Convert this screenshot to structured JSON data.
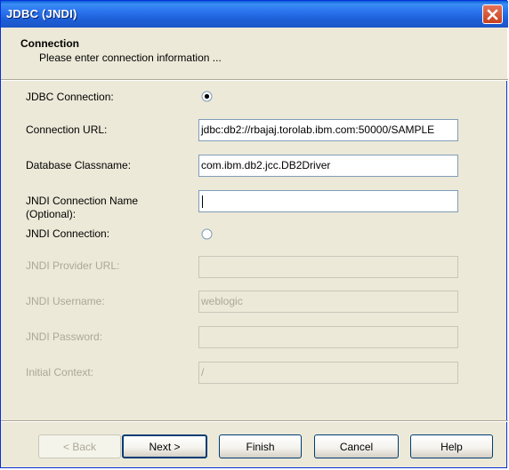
{
  "window": {
    "title": "JDBC (JNDI)"
  },
  "header": {
    "title": "Connection",
    "subtitle": "Please enter connection information ..."
  },
  "form": {
    "jdbc_connection_label": "JDBC Connection:",
    "connection_url_label": "Connection URL:",
    "connection_url_value": "jdbc:db2://rbajaj.torolab.ibm.com:50000/SAMPLE",
    "db_classname_label": "Database Classname:",
    "db_classname_value": "com.ibm.db2.jcc.DB2Driver",
    "jndi_conn_name_label": "JNDI Connection Name",
    "jndi_conn_name_label2": "(Optional):",
    "jndi_conn_name_value": "",
    "jndi_connection_label": "JNDI Connection:",
    "jndi_provider_url_label": "JNDI Provider URL:",
    "jndi_provider_url_value": "",
    "jndi_username_label": "JNDI Username:",
    "jndi_username_value": "weblogic",
    "jndi_password_label": "JNDI Password:",
    "jndi_password_value": "",
    "initial_context_label": "Initial Context:",
    "initial_context_value": "/",
    "selected_connection_type": "JDBC Connection"
  },
  "buttons": {
    "back": "< Back",
    "next": "Next >",
    "finish": "Finish",
    "cancel": "Cancel",
    "help": "Help"
  },
  "colors": {
    "titlebar": "#2a74ee",
    "dialog_bg": "#ece9d8",
    "disabled_text": "#aca899",
    "close_button": "#c6401f"
  },
  "icons": {
    "close": "close-icon",
    "radio_selected": "radio-selected-icon",
    "radio_unselected": "radio-unselected-icon"
  }
}
